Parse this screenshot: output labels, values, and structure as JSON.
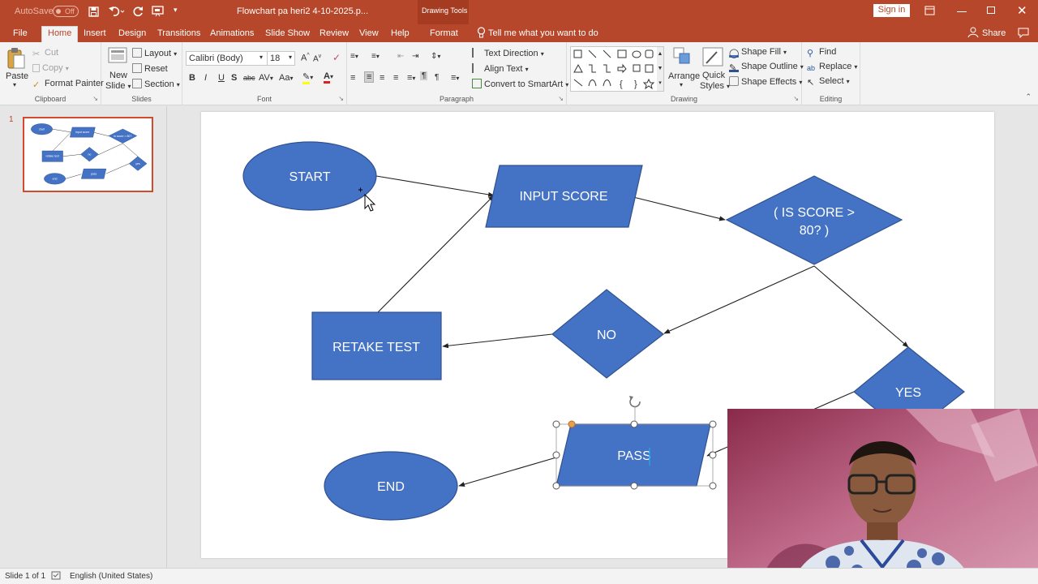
{
  "titlebar": {
    "autosave_label": "AutoSave",
    "autosave_state": "Off",
    "file_title": "Flowchart pa heri2 4-10-2025.p...",
    "context_label": "Drawing Tools",
    "tell_me": "Tell me what you want to do",
    "sign_in": "Sign in",
    "share": "Share"
  },
  "tabs": [
    "File",
    "Home",
    "Insert",
    "Design",
    "Transitions",
    "Animations",
    "Slide Show",
    "Review",
    "View",
    "Help",
    "Format"
  ],
  "active_tab": "Home",
  "ribbon": {
    "clipboard": {
      "paste": "Paste",
      "cut": "Cut",
      "copy": "Copy",
      "format_painter": "Format Painter",
      "label": "Clipboard"
    },
    "slides": {
      "new_slide_1": "New",
      "new_slide_2": "Slide",
      "layout": "Layout",
      "reset": "Reset",
      "section": "Section",
      "label": "Slides"
    },
    "font": {
      "family": "Calibri (Body)",
      "size": "18",
      "bold": "B",
      "italic": "I",
      "underline": "U",
      "shadow": "S",
      "strike": "abc",
      "spacing": "AV",
      "case": "Aa",
      "label": "Font"
    },
    "paragraph": {
      "text_direction": "Text Direction",
      "align_text": "Align Text",
      "smartart": "Convert to SmartArt",
      "label": "Paragraph"
    },
    "drawing": {
      "arrange": "Arrange",
      "quick_styles_1": "Quick",
      "quick_styles_2": "Styles",
      "shape_fill": "Shape Fill",
      "shape_outline": "Shape Outline",
      "shape_effects": "Shape Effects",
      "label": "Drawing"
    },
    "editing": {
      "find": "Find",
      "replace": "Replace",
      "select": "Select",
      "label": "Editing"
    }
  },
  "slide_panel": {
    "slide_number": "1"
  },
  "flowchart": {
    "start": "START",
    "input": "INPUT SCORE",
    "decision_1": "( IS SCORE >",
    "decision_2": "80? )",
    "no": "NO",
    "retake": "RETAKE TEST",
    "yes": "YES",
    "pass": "PASS",
    "end": "END"
  },
  "thumb_labels": {
    "start": "start",
    "input": "input score",
    "decision": "is score > 80?",
    "no": "no",
    "retake": "retake test",
    "yes": "yes",
    "pass": "pass",
    "end": "end"
  },
  "colors": {
    "accent": "#b7472a",
    "shape_fill": "#4472c4",
    "shape_stroke": "#2f528f"
  },
  "statusbar": {
    "slide_info": "Slide 1 of 1",
    "language": "English (United States)"
  }
}
